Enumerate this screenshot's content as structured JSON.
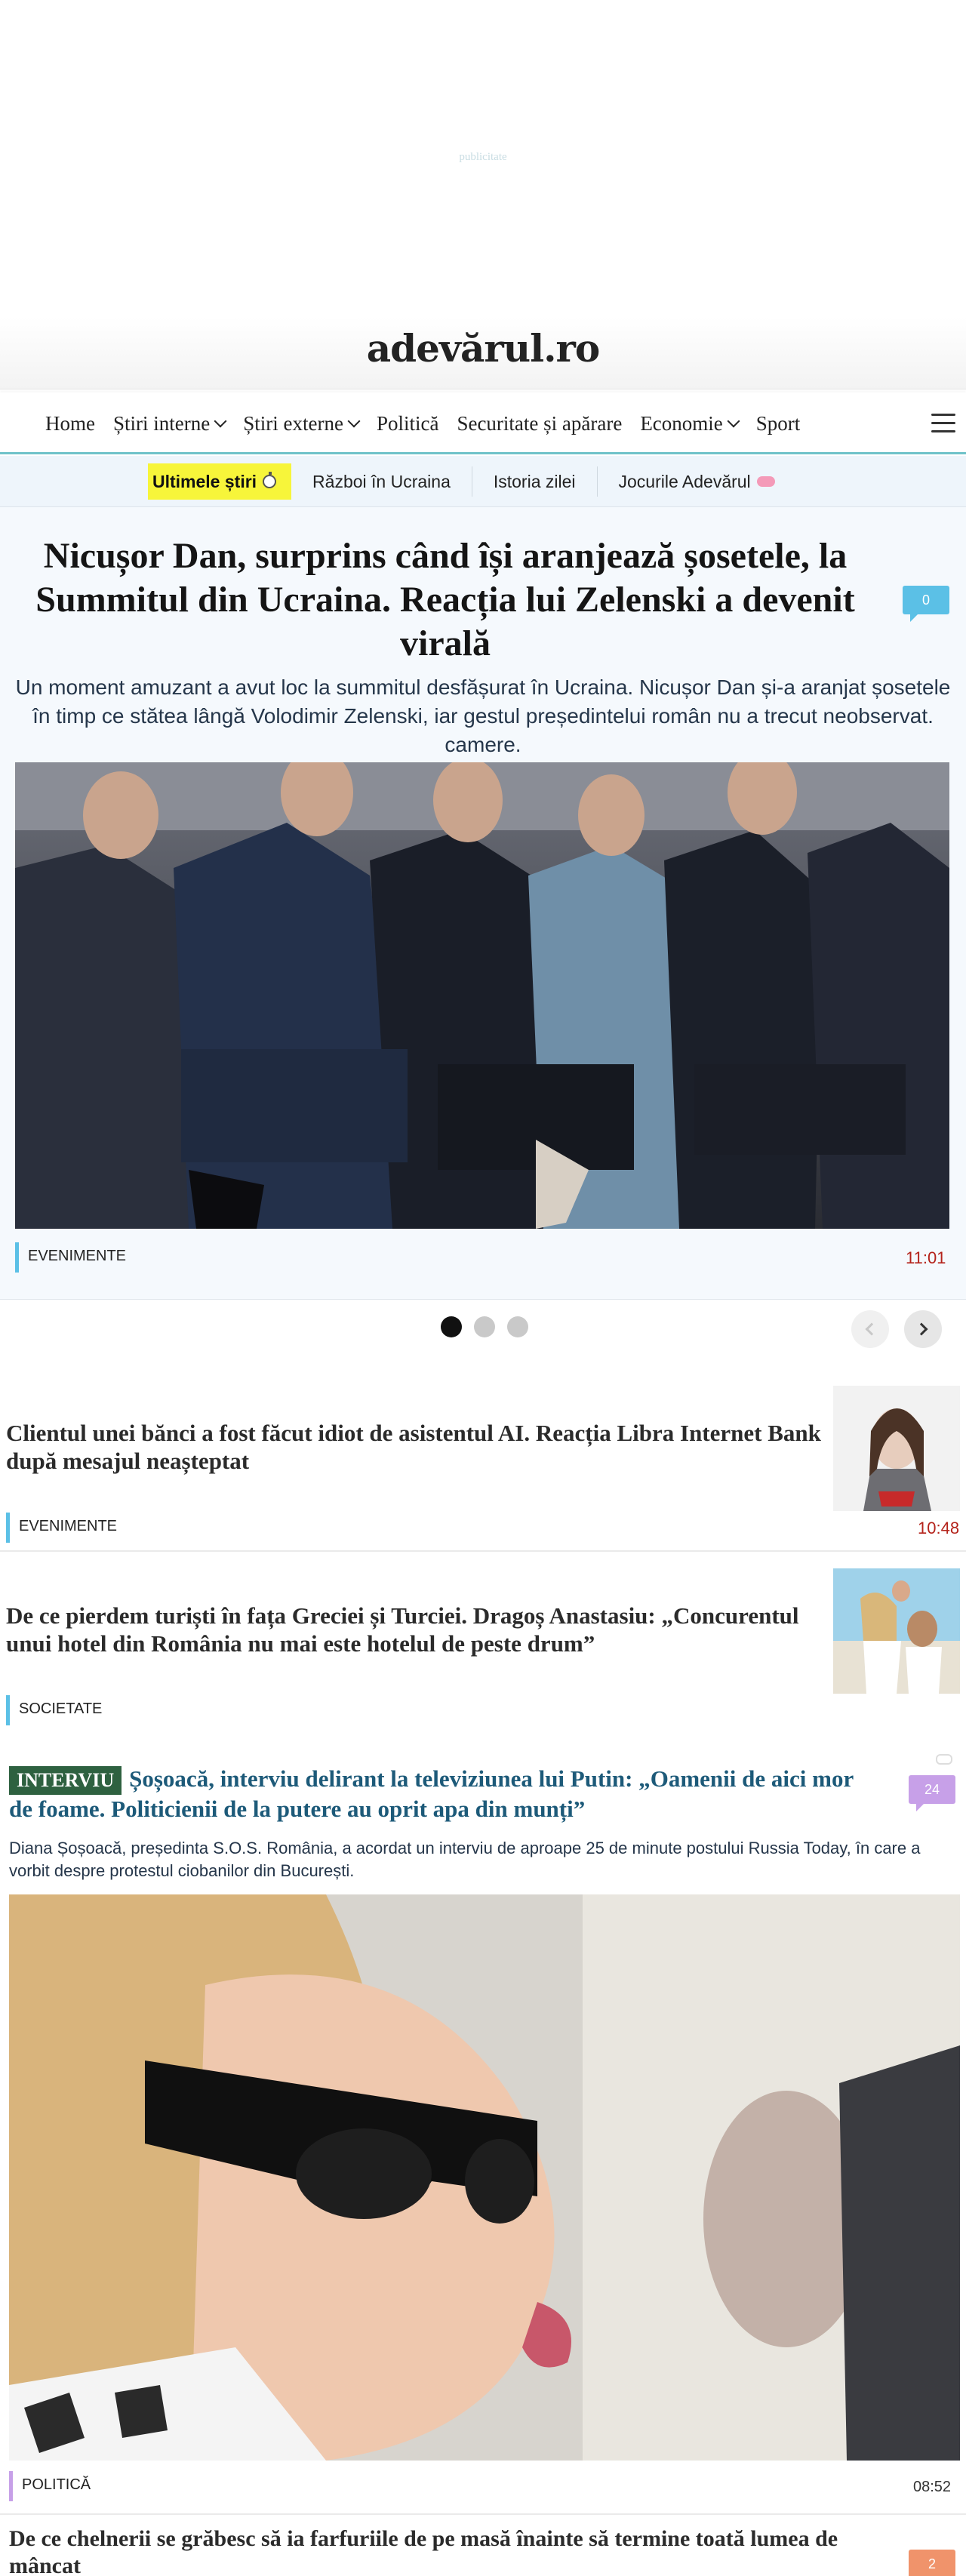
{
  "ad": {
    "label": "publicitate"
  },
  "brand": {
    "logo_text": "adevărul.ro"
  },
  "nav": {
    "items": [
      {
        "label": "Home",
        "dropdown": false
      },
      {
        "label": "Știri interne",
        "dropdown": true
      },
      {
        "label": "Știri externe",
        "dropdown": true
      },
      {
        "label": "Politică",
        "dropdown": false
      },
      {
        "label": "Securitate și apărare",
        "dropdown": false
      },
      {
        "label": "Economie",
        "dropdown": true
      },
      {
        "label": "Sport",
        "dropdown": false
      }
    ],
    "menu_icon": "hamburger-icon"
  },
  "subnav": {
    "highlight": "Ultimele știri",
    "highlight_icon": "stopwatch-icon",
    "items": [
      "Război în Ucraina",
      "Istoria zilei",
      "Jocurile Adevărul"
    ],
    "last_icon": "brain-icon"
  },
  "hero": {
    "title": "Nicușor Dan, surprins când își aranjează șosetele, la Summitul din Ucraina. Reacția lui Zelenski a devenit virală",
    "comments": "0",
    "lead": "Un moment amuzant a avut loc la summitul desfășurat în Ucraina. Nicușor Dan și-a aranjat șosetele în timp ce stătea lângă Volodimir Zelenski, iar gestul președintelui român nu a trecut neobservat. camere.",
    "category": "EVENIMENTE",
    "time": "11:01"
  },
  "carousel": {
    "slides": 3,
    "active": 1
  },
  "articles": [
    {
      "title": "Clientul unei bănci a fost făcut idiot de asistentul AI. Reacția Libra Internet Bank după mesajul neașteptat",
      "category": "EVENIMENTE",
      "time": "10:48"
    },
    {
      "title": "De ce pierdem turiști în fața Greciei și Turciei. Dragoș Anastasiu: „Concurentul unui hotel din România nu mai este hotelul de peste drum”",
      "category": "SOCIETATE"
    },
    {
      "badge": "INTERVIU",
      "title": "Șoșoacă, interviu delirant la televiziunea lui Putin: „Oamenii de aici mor de foame. Politicienii de la putere au oprit apa din munți”",
      "comments": "24",
      "lead": "Diana Șoșoacă, președinta S.O.S. România, a acordat un interviu de aproape 25 de minute postului Russia Today, în care a vorbit despre protestul ciobanilor din București.",
      "category": "POLITICĂ",
      "time": "08:52"
    },
    {
      "title": "De ce chelnerii se grăbesc să ia farfuriile de pe masă înainte să termine toată lumea de mâncat",
      "comments": "2"
    }
  ],
  "colors": {
    "accent_teal": "#6fc2c9",
    "highlight_yellow": "#f7f53a",
    "time_red": "#b4231b",
    "interviu_green": "#2e6140"
  }
}
